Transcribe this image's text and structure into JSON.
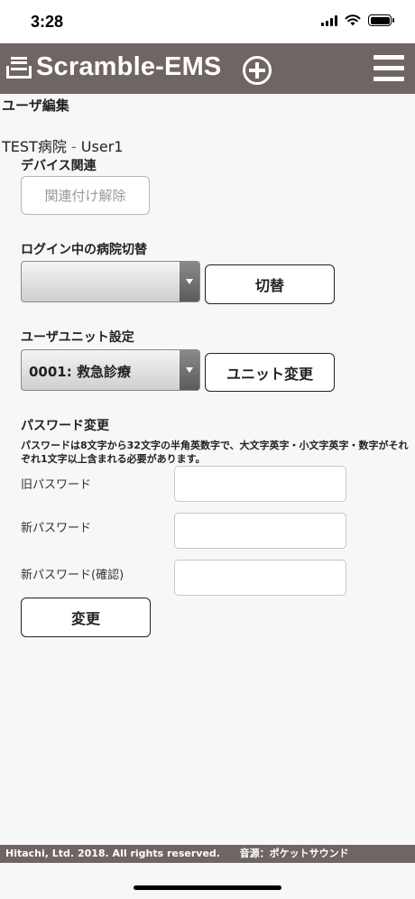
{
  "status_bar": {
    "time": "3:28",
    "icons": [
      "signal-icon",
      "wifi-icon",
      "battery-icon"
    ]
  },
  "app_bar": {
    "logo_text": "Scramble-EMS",
    "icons": [
      "tray-logo-icon",
      "plus-circle-icon",
      "hamburger-menu-icon"
    ],
    "background_color": "#6f6663"
  },
  "page": {
    "title": "ユーザ編集",
    "hospital": "TEST病院",
    "separator": "-",
    "user": "User1"
  },
  "device": {
    "label": "デバイス関連",
    "unlink_button": "関連付け解除"
  },
  "hospital_switch": {
    "label": "ログイン中の病院切替",
    "selected_value": "",
    "button": "切替"
  },
  "user_unit": {
    "label": "ユーザユニット設定",
    "selected_value": "0001: 救急診療",
    "button": "ユニット変更"
  },
  "password": {
    "label": "パスワード変更",
    "description": "パスワードは8文字から32文字の半角英数字で、大文字英字・小文字英字・数字がそれぞれ1文字以上含まれる必要があります。",
    "old_label": "旧パスワード",
    "new_label": "新パスワード",
    "confirm_label": "新パスワード(確認)",
    "old_value": "",
    "new_value": "",
    "confirm_value": "",
    "submit_button": "変更"
  },
  "footer": {
    "copyright": "Hitachi, Ltd. 2018. All rights reserved.",
    "sound_credit": "音源：ポケットサウンド"
  }
}
